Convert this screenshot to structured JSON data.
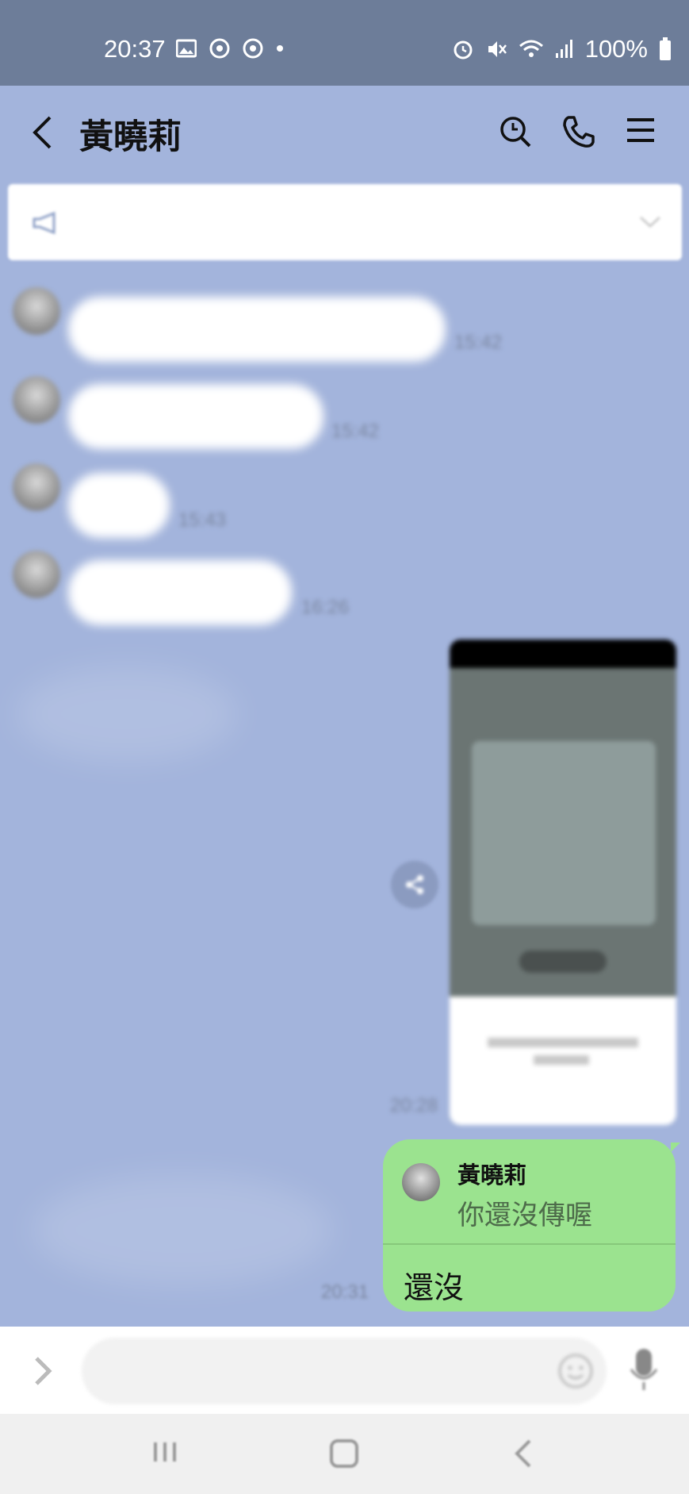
{
  "status_bar": {
    "time": "20:37",
    "battery": "100%"
  },
  "header": {
    "title": "黃曉莉"
  },
  "messages": {
    "times": [
      "15:42",
      "15:42",
      "15:43",
      "16:26"
    ],
    "image_time": "20:28",
    "reply_time": "20:31"
  },
  "reply": {
    "quoted_name": "黃曉莉",
    "quoted_text": "你還沒傳喔",
    "text": "還沒"
  },
  "colors": {
    "chat_bg": "#a3b4dc",
    "my_bubble": "#9be38f",
    "status_bar": "#6d7d99"
  }
}
